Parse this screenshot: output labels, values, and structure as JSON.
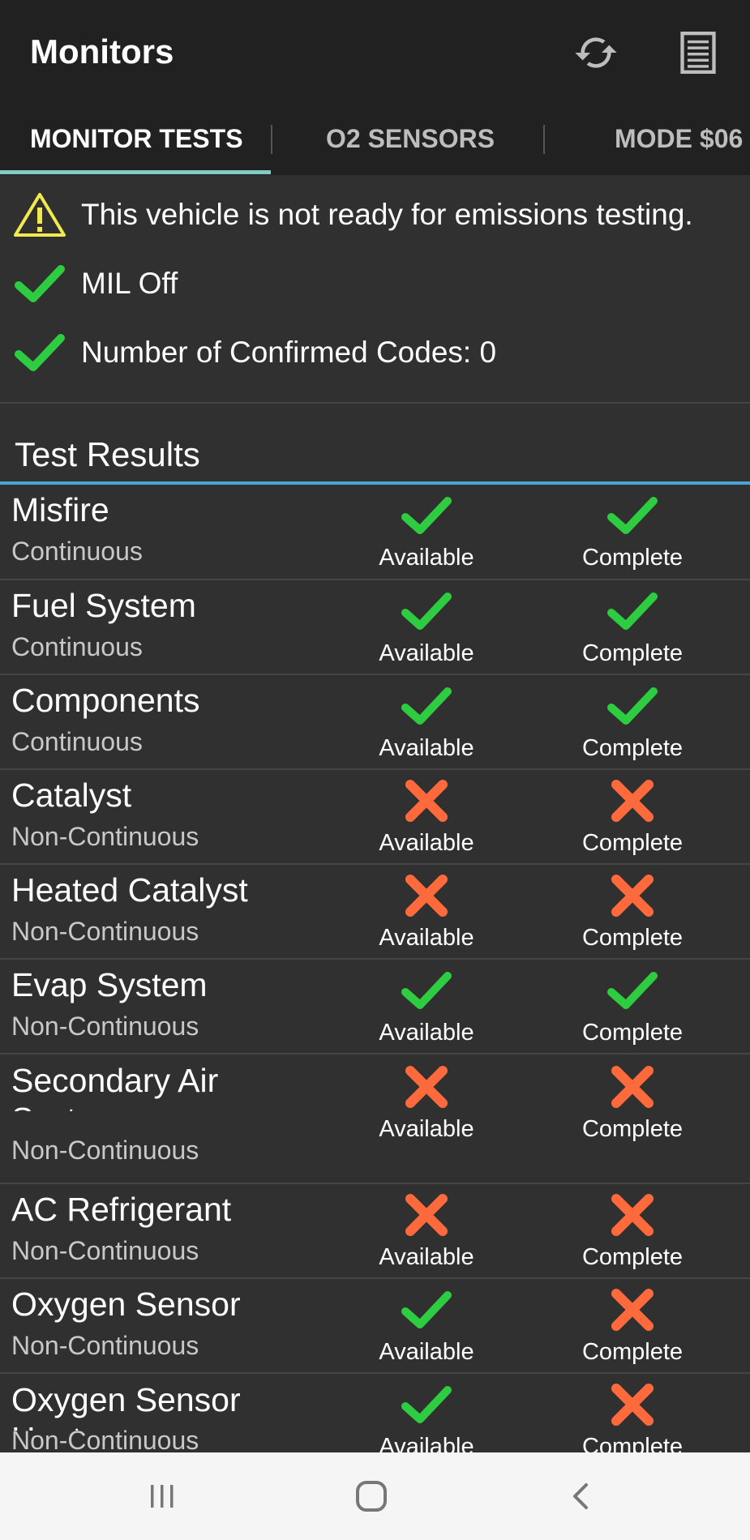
{
  "app": {
    "title": "Monitors"
  },
  "colors": {
    "ok": "#2ecc40",
    "fail": "#ff6a3d",
    "warn": "#f2e94e",
    "accent": "#80cbc4",
    "section": "#4aa3d4"
  },
  "tabs": [
    {
      "label": "MONITOR TESTS",
      "active": true
    },
    {
      "label": "O2 SENSORS",
      "active": false
    },
    {
      "label": "MODE $06",
      "active": false
    }
  ],
  "status": [
    {
      "icon": "warning-icon",
      "text": "This vehicle is not ready for emissions testing."
    },
    {
      "icon": "check-icon",
      "text": "MIL Off"
    },
    {
      "icon": "check-icon",
      "text": "Number of Confirmed Codes: 0"
    }
  ],
  "section": {
    "title": "Test Results"
  },
  "labels": {
    "available": "Available",
    "complete": "Complete"
  },
  "tests": [
    {
      "name": "Misfire",
      "type": "Continuous",
      "available": true,
      "complete": true
    },
    {
      "name": "Fuel System",
      "type": "Continuous",
      "available": true,
      "complete": true
    },
    {
      "name": "Components",
      "type": "Continuous",
      "available": true,
      "complete": true
    },
    {
      "name": "Catalyst",
      "type": "Non-Continuous",
      "available": false,
      "complete": false
    },
    {
      "name": "Heated Catalyst",
      "type": "Non-Continuous",
      "available": false,
      "complete": false
    },
    {
      "name": "Evap System",
      "type": "Non-Continuous",
      "available": true,
      "complete": true
    },
    {
      "name": "Secondary Air System",
      "type": "Non-Continuous",
      "available": false,
      "complete": false
    },
    {
      "name": "AC Refrigerant",
      "type": "Non-Continuous",
      "available": false,
      "complete": false
    },
    {
      "name": "Oxygen Sensor",
      "type": "Non-Continuous",
      "available": true,
      "complete": false
    },
    {
      "name": "Oxygen Sensor Heater",
      "type": "Non-Continuous",
      "available": true,
      "complete": false
    }
  ]
}
